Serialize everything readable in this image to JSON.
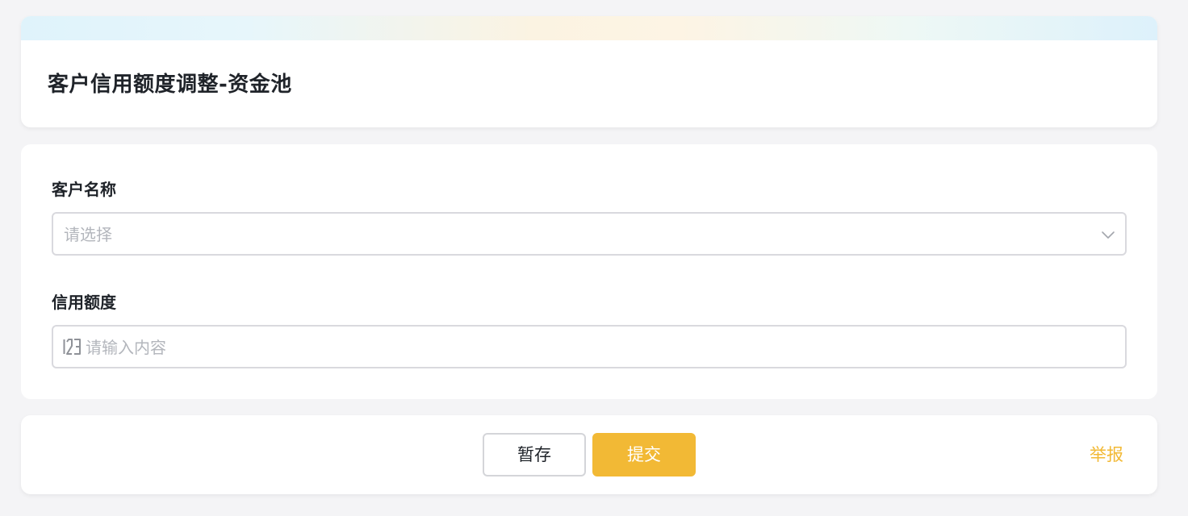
{
  "header": {
    "title": "客户信用额度调整-资金池"
  },
  "form": {
    "customer_name": {
      "label": "客户名称",
      "placeholder": "请选择",
      "icon": "chevron-down-icon"
    },
    "credit_limit": {
      "label": "信用额度",
      "placeholder": "请输入内容",
      "value": "",
      "icon": "number-123-icon"
    }
  },
  "footer": {
    "save_label": "暂存",
    "submit_label": "提交",
    "report_label": "举报"
  },
  "colors": {
    "accent": "#f2b935",
    "background": "#f4f4f6",
    "border": "#d9d9de",
    "placeholder": "#b3b6bc",
    "text": "#1f2329"
  }
}
